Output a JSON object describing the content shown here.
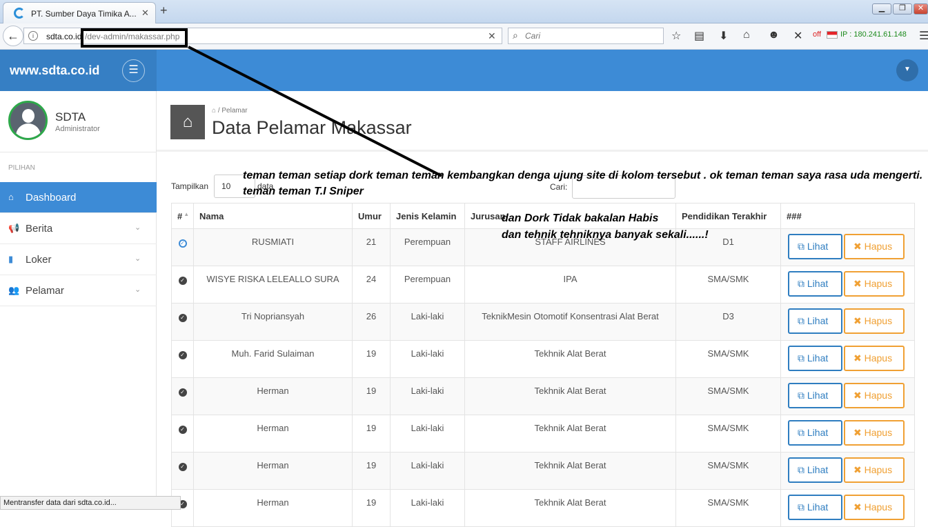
{
  "browser": {
    "tab_title": "PT. Sumber Daya Timika A...",
    "new_tab": "+",
    "url_domain": "sdta.co.id",
    "url_path": "/dev-admin/makassar.php",
    "search_placeholder": "Cari",
    "status_off": "off",
    "ip": "IP : 180.241.61.148",
    "status_bar": "Mentransfer data dari sdta.co.id..."
  },
  "app": {
    "brand": "www.sdta.co.id",
    "user": {
      "name": "SDTA",
      "role": "Administrator"
    },
    "menu_header": "PILIHAN",
    "menu": [
      {
        "label": "Dashboard",
        "icon": "home-icon",
        "active": true
      },
      {
        "label": "Berita",
        "icon": "megaphone-icon"
      },
      {
        "label": "Loker",
        "icon": "book-icon"
      },
      {
        "label": "Pelamar",
        "icon": "users-icon"
      }
    ],
    "breadcrumb": "Pelamar",
    "page_title": "Data Pelamar Makassar",
    "length_label": "Tampilkan",
    "length_value": "10",
    "length_suffix": "data",
    "filter_label": "Cari:"
  },
  "table": {
    "columns": [
      "#",
      "Nama",
      "Umur",
      "Jenis Kelamin",
      "Jurusan",
      "Pendidikan Terakhir",
      "###"
    ],
    "view_label": "Lihat",
    "delete_label": "Hapus",
    "rows": [
      {
        "nama": "RUSMIATI",
        "umur": "21",
        "jk": "Perempuan",
        "jurusan": "STAFF AIRLINES",
        "pendidikan": "D1"
      },
      {
        "nama": "WISYE RISKA LELEALLO SURA",
        "umur": "24",
        "jk": "Perempuan",
        "jurusan": "IPA",
        "pendidikan": "SMA/SMK"
      },
      {
        "nama": "Tri Nopriansyah",
        "umur": "26",
        "jk": "Laki-laki",
        "jurusan": "TeknikMesin Otomotif Konsentrasi Alat Berat",
        "pendidikan": "D3"
      },
      {
        "nama": "Muh. Farid Sulaiman",
        "umur": "19",
        "jk": "Laki-laki",
        "jurusan": "Tekhnik Alat Berat",
        "pendidikan": "SMA/SMK"
      },
      {
        "nama": "Herman",
        "umur": "19",
        "jk": "Laki-laki",
        "jurusan": "Tekhnik Alat Berat",
        "pendidikan": "SMA/SMK"
      },
      {
        "nama": "Herman",
        "umur": "19",
        "jk": "Laki-laki",
        "jurusan": "Tekhnik Alat Berat",
        "pendidikan": "SMA/SMK"
      },
      {
        "nama": "Herman",
        "umur": "19",
        "jk": "Laki-laki",
        "jurusan": "Tekhnik Alat Berat",
        "pendidikan": "SMA/SMK"
      },
      {
        "nama": "Herman",
        "umur": "19",
        "jk": "Laki-laki",
        "jurusan": "Tekhnik Alat Berat",
        "pendidikan": "SMA/SMK"
      }
    ]
  },
  "annotations": {
    "text_1": "teman teman setiap dork teman teman kembangkan denga ujung site di kolom tersebut . ok teman teman saya rasa uda mengerti. teman teman T.I Sniper",
    "text_2_line1": "dan Dork Tidak bakalan Habis",
    "text_2_line2": "dan tehnik tehniknya banyak sekali......!"
  }
}
